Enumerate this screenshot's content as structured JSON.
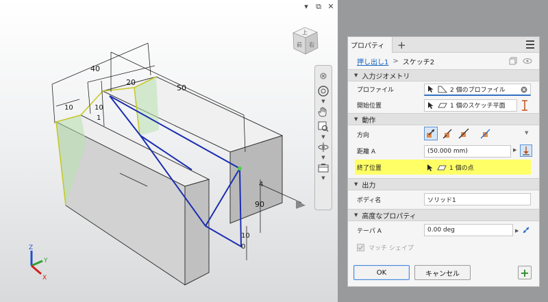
{
  "window_controls": {
    "minimize": "▾",
    "restore": "⧉",
    "close": "✕"
  },
  "viewcube": {
    "top": "上",
    "front": "前",
    "right": "右"
  },
  "dimensions": {
    "d40": "40",
    "d20": "20",
    "d50": "50",
    "d10a": "10",
    "d10b": "10",
    "d1": "1",
    "d4": "4",
    "d90": "90",
    "d10c": "10",
    "d0": "0"
  },
  "triad": {
    "z": "Z",
    "y": "Y",
    "x": "X"
  },
  "panel": {
    "tab_label": "プロパティ",
    "tab_add": "+",
    "breadcrumb": {
      "link": "押し出し1",
      "separator": ">",
      "current": "スケッチ2"
    },
    "sections": {
      "input_geometry": "入力ジオメトリ",
      "behavior": "動作",
      "output": "出力",
      "advanced": "高度なプロパティ"
    },
    "rows": {
      "profile": {
        "label": "プロファイル",
        "value": "2 個のプロファイル"
      },
      "start": {
        "label": "開始位置",
        "value": "1 個のスケッチ平面"
      },
      "direction": {
        "label": "方向"
      },
      "distance": {
        "label": "距離 A",
        "value": "(50.000 mm)"
      },
      "termination": {
        "label": "終了位置",
        "value": "1 個の点"
      },
      "body_name": {
        "label": "ボディ名",
        "value": "ソリッド1"
      },
      "taper": {
        "label": "テーパ A",
        "value": "0.00 deg"
      },
      "match_shape": {
        "label": "マッチ シェイプ",
        "checked": true
      }
    },
    "buttons": {
      "ok": "OK",
      "cancel": "キャンセル",
      "add": "+"
    }
  },
  "colors": {
    "accent_blue": "#1565c0",
    "highlight_yellow": "#ffff66",
    "sketch_blue": "#1a2db0",
    "edge_yellow": "#c8c82a",
    "add_green": "#2e8b2e"
  }
}
